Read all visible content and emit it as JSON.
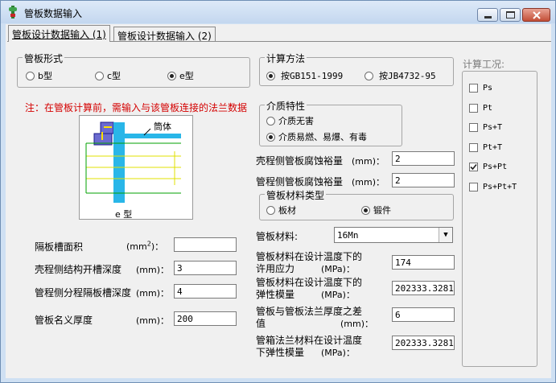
{
  "window": {
    "title": "管板数据输入"
  },
  "tabs": [
    {
      "label": "管板设计数据输入 (1)"
    },
    {
      "label": "管板设计数据输入 (2)"
    }
  ],
  "tubesheet_form": {
    "title": "管板形式",
    "options": [
      {
        "label": "b型",
        "checked": false
      },
      {
        "label": "c型",
        "checked": false
      },
      {
        "label": "e型",
        "checked": true
      }
    ]
  },
  "note": "注：在管板计算前，需输入与该管板连接的法兰数据",
  "diagram": {
    "shell_label": "筒体",
    "type_label": "e 型"
  },
  "calc_method": {
    "title": "计算方法",
    "options": [
      {
        "label": "按GB151-1999",
        "checked": true
      },
      {
        "label": "按JB4732-95",
        "checked": false
      }
    ]
  },
  "medium": {
    "title": "介质特性",
    "options": [
      {
        "label": "介质无害",
        "checked": false
      },
      {
        "label": "介质易燃、易爆、有毒",
        "checked": true
      }
    ]
  },
  "conditions": {
    "title": "计算工况:",
    "items": [
      {
        "label": "Ps",
        "checked": false
      },
      {
        "label": "Pt",
        "checked": false
      },
      {
        "label": "Ps+T",
        "checked": false
      },
      {
        "label": "Pt+T",
        "checked": false
      },
      {
        "label": "Ps+Pt",
        "checked": true
      },
      {
        "label": "Ps+Pt+T",
        "checked": false
      }
    ]
  },
  "fields": {
    "shell_corrosion": {
      "label": "壳程侧管板腐蚀裕量",
      "unit": "(mm)：",
      "value": "2"
    },
    "tube_corrosion": {
      "label": "管程侧管板腐蚀裕量",
      "unit": "(mm)：",
      "value": "2"
    },
    "partition_area": {
      "label": "隔板槽面积",
      "unit_a": "(mm",
      "unit_sup": "2",
      "unit_b": ")：",
      "value": ""
    },
    "shell_groove_depth": {
      "label": "壳程侧结构开槽深度",
      "unit": "(mm)：",
      "value": "3"
    },
    "tube_partition_depth": {
      "label": "管程侧分程隔板槽深度",
      "unit": "(mm)：",
      "value": "4"
    },
    "nominal_thickness": {
      "label": "管板名义厚度",
      "unit": "(mm)：",
      "value": "200"
    },
    "allowable_stress": {
      "line1": "管板材料在设计温度下的",
      "line2": "许用应力",
      "unit": "(MPa)：",
      "value": "174"
    },
    "elastic_modulus": {
      "line1": "管板材料在设计温度下的",
      "line2": "弹性模量",
      "unit": "(MPa)：",
      "value": "202333.3281"
    },
    "thickness_diff": {
      "line1": "管板与管板法兰厚度之差",
      "line2": "值",
      "unit": "(mm)：",
      "value": "6"
    },
    "flange_modulus": {
      "line1": "管箱法兰材料在设计温度",
      "line2": "下弹性模量",
      "unit": "(MPa)：",
      "value": "202333.3281"
    }
  },
  "material_type": {
    "title": "管板材料类型",
    "options": [
      {
        "label": "板材",
        "checked": false
      },
      {
        "label": "锻件",
        "checked": true
      }
    ]
  },
  "material": {
    "label": "管板材料:",
    "value": "16Mn"
  }
}
